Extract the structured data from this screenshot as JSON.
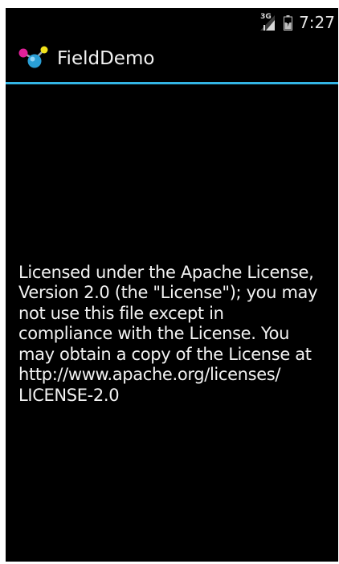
{
  "status_bar": {
    "network_type": "3G",
    "time": "7:27",
    "icons": [
      "signal-icon",
      "battery-icon"
    ]
  },
  "action_bar": {
    "title": "FieldDemo",
    "icon": "app-molecule-icon",
    "divider_color": "#33b5e5"
  },
  "content": {
    "text": "Licensed under the Apache License,\nVersion 2.0 (the \"License\"); you may\nnot use this file except in\ncompliance with the License. You\nmay obtain a copy of the License at\nhttp://www.apache.org/licenses/\nLICENSE-2.0"
  }
}
